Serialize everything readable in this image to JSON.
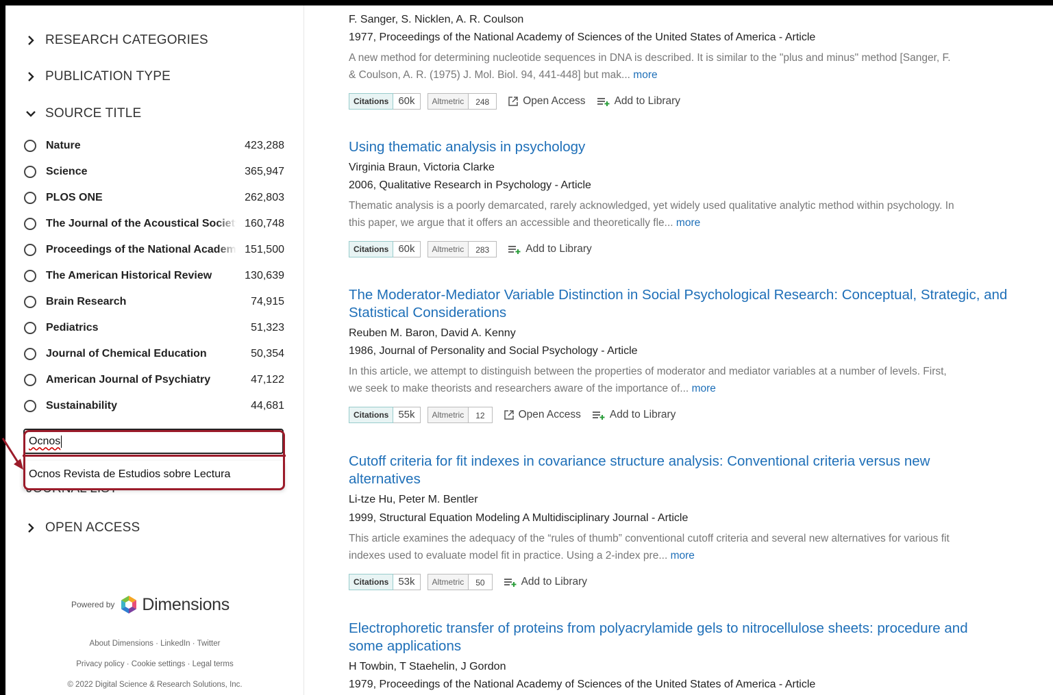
{
  "sidebar": {
    "facets": {
      "research_categories": "RESEARCH CATEGORIES",
      "publication_type": "PUBLICATION TYPE",
      "source_title": "SOURCE TITLE",
      "journal_list": "JOURNAL LIST",
      "open_access": "OPEN ACCESS"
    },
    "sources": [
      {
        "name": "Nature",
        "count": "423,288"
      },
      {
        "name": "Science",
        "count": "365,947"
      },
      {
        "name": "PLOS ONE",
        "count": "262,803"
      },
      {
        "name": "The Journal of the Acoustical Society of America",
        "count": "160,748"
      },
      {
        "name": "Proceedings of the National Academy of Sciences",
        "count": "151,500"
      },
      {
        "name": "The American Historical Review",
        "count": "130,639"
      },
      {
        "name": "Brain Research",
        "count": "74,915"
      },
      {
        "name": "Pediatrics",
        "count": "51,323"
      },
      {
        "name": "Journal of Chemical Education",
        "count": "50,354"
      },
      {
        "name": "American Journal of Psychiatry",
        "count": "47,122"
      },
      {
        "name": "Sustainability",
        "count": "44,681"
      }
    ],
    "search": {
      "value": "Ocnos"
    },
    "suggestion": "Ocnos Revista de Estudios sobre Lectura",
    "footer": {
      "powered_by": "Powered by",
      "brand": "Dimensions",
      "links1": "About Dimensions · LinkedIn · Twitter",
      "links2": "Privacy policy · Cookie settings · Legal terms",
      "copyright": "© 2022 Digital Science & Research Solutions, Inc."
    }
  },
  "labels": {
    "citations": "Citations",
    "altmetric": "Altmetric",
    "open_access": "Open Access",
    "add_to_library": "Add to Library",
    "more": "more"
  },
  "articles": [
    {
      "authors": "F. Sanger, S. Nicklen, A. R. Coulson",
      "pub": "1977, Proceedings of the National Academy of Sciences of the United States of America - Article",
      "abstract_l1": "A new method for determining nucleotide sequences in DNA is described. It is similar to the \"plus and minus\" method [Sanger, F.",
      "abstract_l2": "& Coulson, A. R. (1975) J. Mol. Biol. 94, 441-448] but mak...",
      "citations": "60k",
      "altmetric": "248"
    },
    {
      "title": "Using thematic analysis in psychology",
      "authors": "Virginia Braun, Victoria Clarke",
      "pub": "2006, Qualitative Research in Psychology - Article",
      "abstract_l1": "Thematic analysis is a poorly demarcated, rarely acknowledged, yet widely used qualitative analytic method within psychology. In",
      "abstract_l2": "this paper, we argue that it offers an accessible and theoretically fle...",
      "citations": "60k",
      "altmetric": "283"
    },
    {
      "title_l1": "The Moderator-Mediator Variable Distinction in Social Psychological Research: Conceptual, Strategic, and",
      "title_l2": "Statistical Considerations",
      "authors": "Reuben M. Baron, David A. Kenny",
      "pub": "1986, Journal of Personality and Social Psychology - Article",
      "abstract_l1": "In this article, we attempt to distinguish between the properties of moderator and mediator variables at a number of levels. First,",
      "abstract_l2": "we seek to make theorists and researchers aware of the importance of...",
      "citations": "55k",
      "altmetric": "12"
    },
    {
      "title_l1": "Cutoff criteria for fit indexes in covariance structure analysis: Conventional criteria versus new",
      "title_l2": "alternatives",
      "authors": "Li-tze Hu, Peter M. Bentler",
      "pub": "1999, Structural Equation Modeling A Multidisciplinary Journal - Article",
      "abstract_l1": "This article examines the adequacy of the “rules of thumb” conventional cutoff criteria and several new alternatives for various fit",
      "abstract_l2": "indexes used to evaluate model fit in practice. Using a 2-index pre...",
      "citations": "53k",
      "altmetric": "50"
    },
    {
      "title_l1": "Electrophoretic transfer of proteins from polyacrylamide gels to nitrocellulose sheets: procedure and",
      "title_l2": "some applications",
      "authors": "H Towbin, T Staehelin, J Gordon",
      "pub": "1979, Proceedings of the National Academy of Sciences of the United States of America - Article"
    }
  ]
}
